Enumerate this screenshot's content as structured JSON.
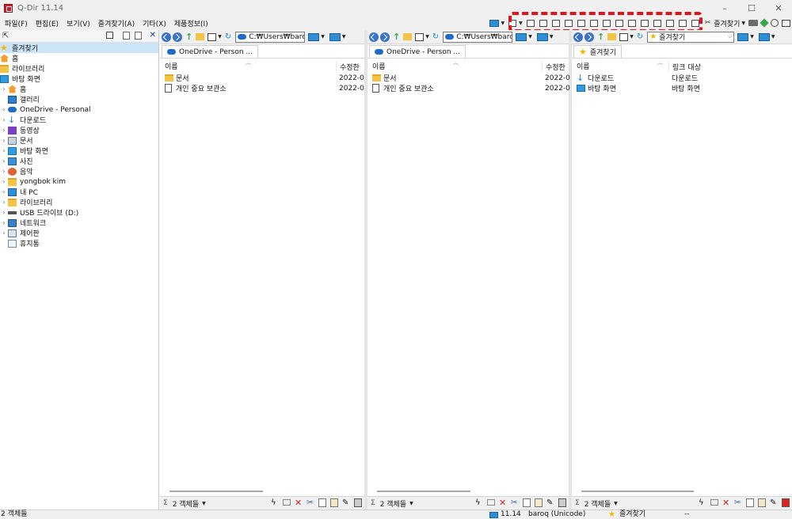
{
  "window": {
    "title": "Q-Dir 11.14",
    "minimize": "–",
    "maximize": "☐",
    "close": "✕"
  },
  "menu": [
    "파일(F)",
    "편집(E)",
    "보기(V)",
    "즐겨찾기(A)",
    "기타(X)",
    "제품정보(I)"
  ],
  "toolbar": {
    "favorites_label": "즐겨찾기"
  },
  "tree": {
    "items": [
      {
        "label": "즐겨찾기",
        "icon": "star-icon",
        "expander": "",
        "indent": 0,
        "selected": true
      },
      {
        "label": "홈",
        "icon": "home-icon",
        "expander": "",
        "indent": 0
      },
      {
        "label": "라이브러리",
        "icon": "folder-icon",
        "expander": "",
        "indent": 0
      },
      {
        "label": "바탕 화면",
        "icon": "desktop-icon",
        "expander": "",
        "indent": 0
      },
      {
        "label": "홈",
        "icon": "home-icon",
        "expander": "›",
        "indent": 1
      },
      {
        "label": "갤러리",
        "icon": "gallery-icon",
        "expander": "",
        "indent": 1
      },
      {
        "label": "OneDrive - Personal",
        "icon": "cloud-icon",
        "expander": "›",
        "indent": 1
      },
      {
        "label": "다운로드",
        "icon": "download-icon",
        "expander": "›",
        "indent": 1
      },
      {
        "label": "동영상",
        "icon": "video-icon",
        "expander": "›",
        "indent": 1
      },
      {
        "label": "문서",
        "icon": "document-icon",
        "expander": "›",
        "indent": 1
      },
      {
        "label": "바탕 화면",
        "icon": "desktop-icon",
        "expander": "›",
        "indent": 1
      },
      {
        "label": "사진",
        "icon": "pictures-icon",
        "expander": "›",
        "indent": 1
      },
      {
        "label": "음악",
        "icon": "music-icon",
        "expander": "›",
        "indent": 1
      },
      {
        "label": "yongbok kim",
        "icon": "folder-icon",
        "expander": "›",
        "indent": 1
      },
      {
        "label": "내 PC",
        "icon": "pc-icon",
        "expander": "›",
        "indent": 1
      },
      {
        "label": "라이브러리",
        "icon": "folder-icon",
        "expander": "›",
        "indent": 1
      },
      {
        "label": "USB 드라이브 (D:)",
        "icon": "usb-icon",
        "expander": "›",
        "indent": 1
      },
      {
        "label": "네트워크",
        "icon": "network-icon",
        "expander": "›",
        "indent": 1
      },
      {
        "label": "제어판",
        "icon": "control-panel-icon",
        "expander": "›",
        "indent": 1
      },
      {
        "label": "휴지통",
        "icon": "recycle-bin-icon",
        "expander": "",
        "indent": 1
      }
    ]
  },
  "panes": [
    {
      "path": "C:₩Users₩barc",
      "tab": "OneDrive - Person ...",
      "tab_icon": "cloud",
      "col_name": "이름",
      "col_date": "수정한",
      "files": [
        {
          "name": "문서",
          "date": "2022-0",
          "icon": "folder"
        },
        {
          "name": "개인 중요 보관소",
          "date": "2022-0",
          "icon": "doc"
        }
      ],
      "status": "2 객체들"
    },
    {
      "path": "C:₩Users₩barc",
      "tab": "OneDrive - Person ...",
      "tab_icon": "cloud",
      "col_name": "이름",
      "col_date": "수정한",
      "files": [
        {
          "name": "문서",
          "date": "2022-0",
          "icon": "folder"
        },
        {
          "name": "개인 중요 보관소",
          "date": "2022-0",
          "icon": "doc"
        }
      ],
      "status": "2 객체들"
    },
    {
      "path": "즐겨찾기",
      "tab": "즐겨찾기",
      "tab_icon": "star",
      "col_name": "이름",
      "col_date": "링크 대상",
      "files": [
        {
          "name": "다운로드",
          "date": "다운로드",
          "icon": "download"
        },
        {
          "name": "바탕 화면",
          "date": "바탕 화면",
          "icon": "desktop"
        }
      ],
      "status": "2 객체들"
    }
  ],
  "statusbar": {
    "objects": "2 객체들",
    "version": "11.14",
    "user": "baroq (Unicode)",
    "favorites": "즐겨찾기",
    "extra": "--"
  }
}
